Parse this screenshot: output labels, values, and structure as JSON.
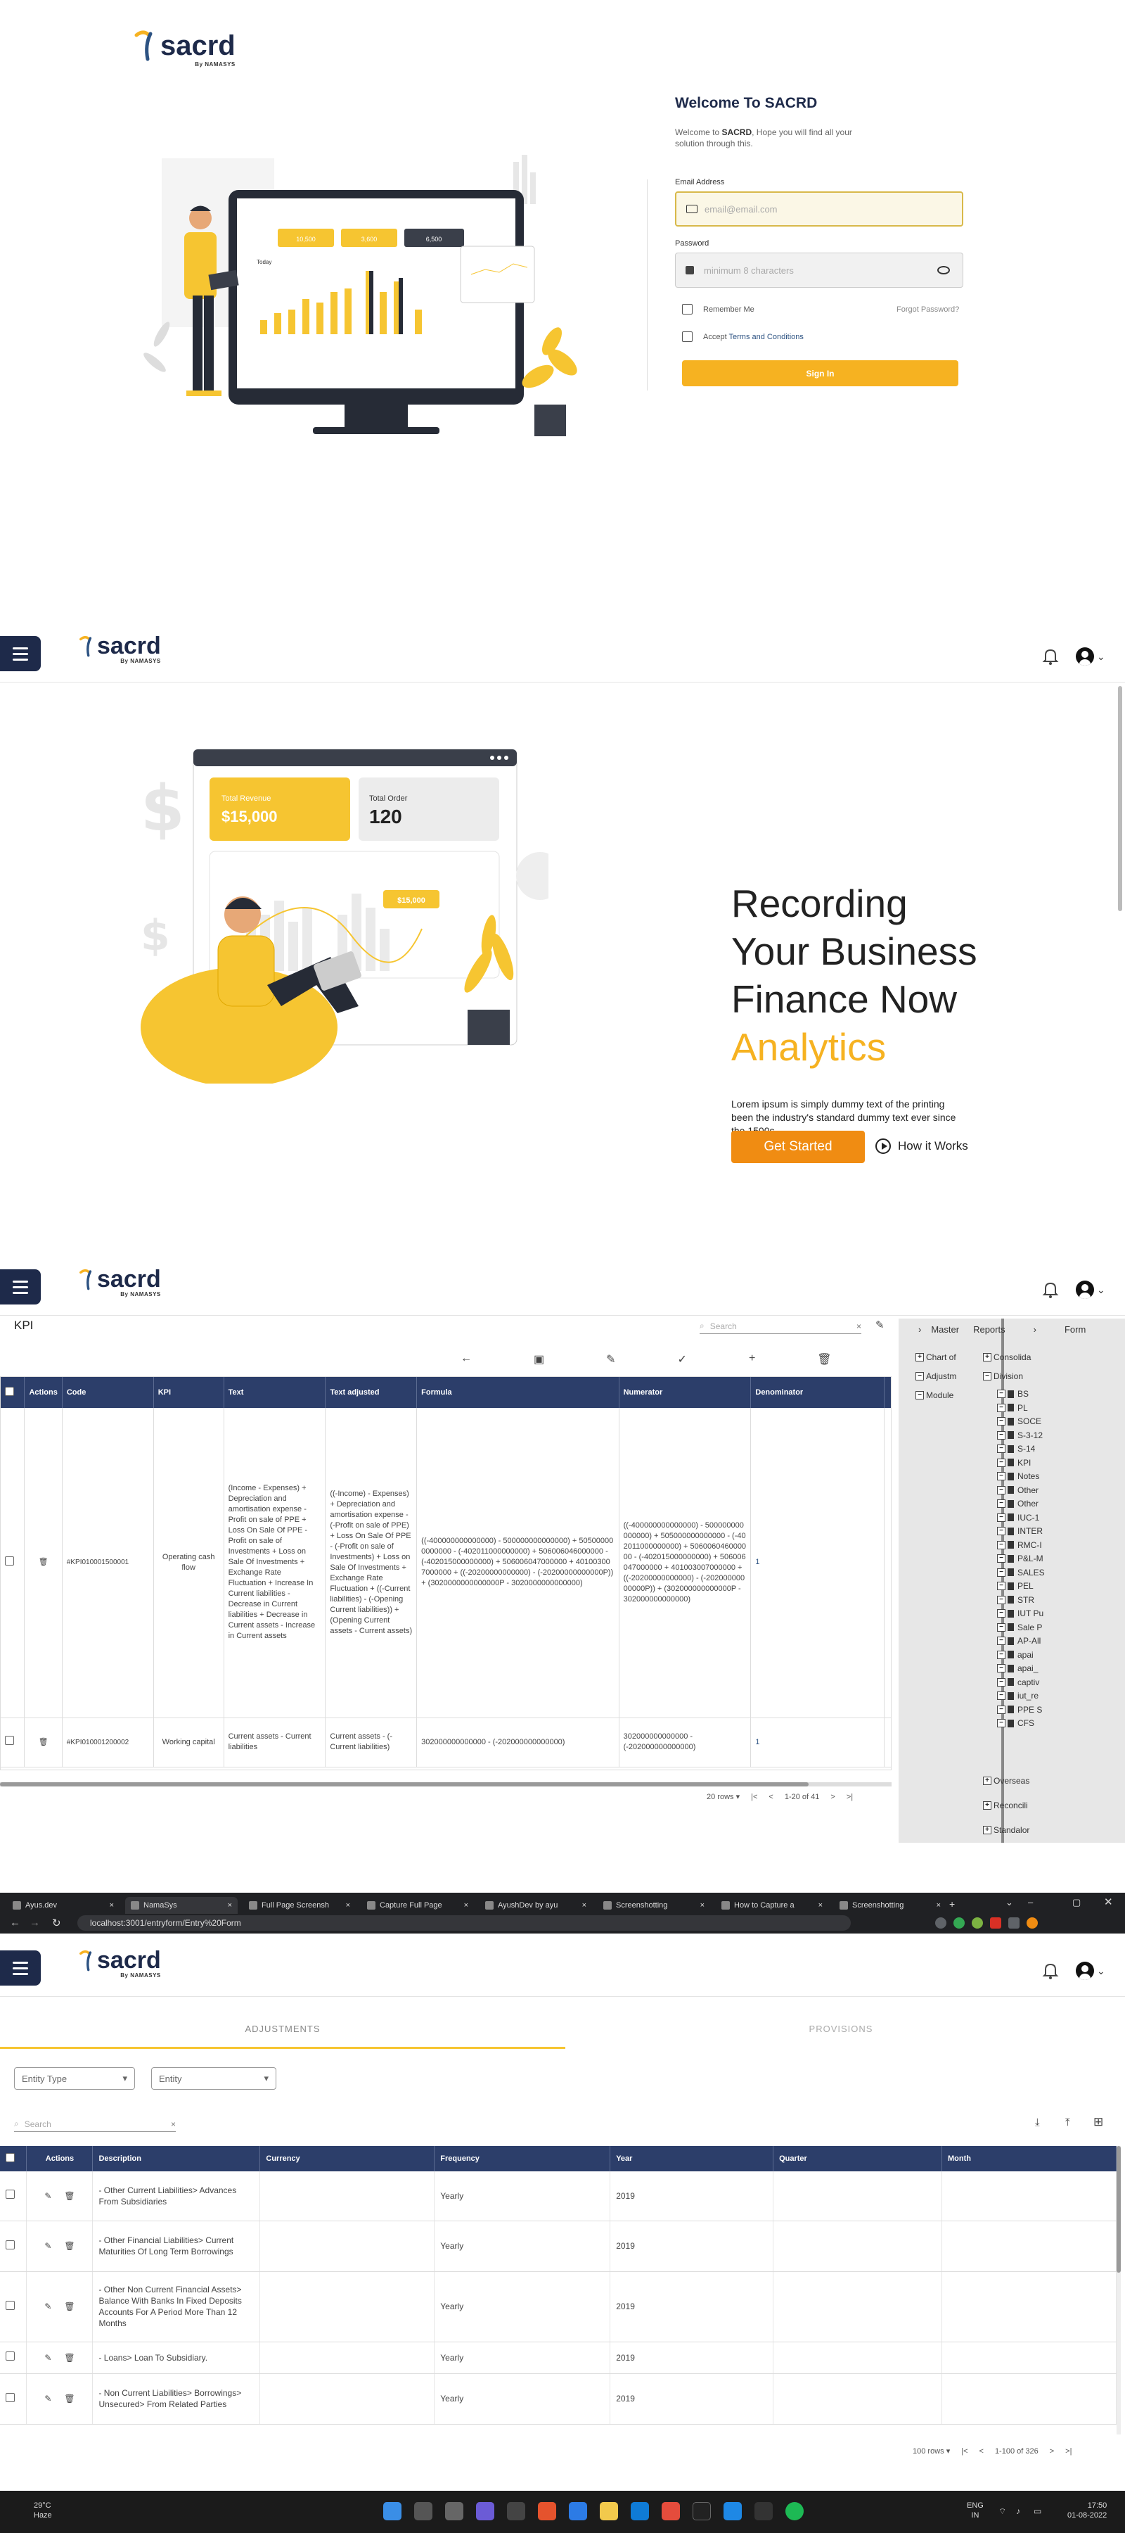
{
  "login": {
    "brand": "sacrd",
    "brand_sub": "By NAMASYS",
    "title": "Welcome To SACRD",
    "subtitle_prefix": "Welcome to ",
    "subtitle_brand": "SACRD",
    "subtitle_rest": ", Hope you will find all your solution through this.",
    "email_label": "Email Address",
    "email_placeholder": "email@email.com",
    "password_label": "Password",
    "password_placeholder": "minimum 8 characters",
    "remember_label": "Remember Me",
    "forgot_label": "Forgot Password?",
    "accept_prefix": "Accept ",
    "terms_label": "Terms and Conditions",
    "signin_label": "Sign In",
    "illus": {
      "stat1": "10,500",
      "stat2": "3,600",
      "stat3": "6,500",
      "today": "Today"
    },
    "accent": "#f6b221"
  },
  "landing": {
    "brand": "sacrd",
    "brand_sub": "By NAMASYS",
    "hero_line1": "Recording",
    "hero_line2": "Your Business",
    "hero_line3": "Finance Now",
    "hero_accent": "Analytics",
    "desc": "Lorem ipsum is simply dummy text of the printing been the industry's standard dummy text ever since the 1500s.",
    "cta_label": "Get Started",
    "how_label": "How it Works",
    "card1_label": "Total Revenue",
    "card1_value": "$15,000",
    "card2_label": "Total Order",
    "card2_value": "120",
    "chart_badge": "$15,000",
    "dollar_sign": "$"
  },
  "kpi": {
    "brand": "sacrd",
    "brand_sub": "By NAMASYS",
    "page_title": "KPI",
    "search_placeholder": "Search",
    "columns": [
      "Actions",
      "Code",
      "KPI",
      "Text",
      "Text adjusted",
      "Formula",
      "Numerator",
      "Denominator"
    ],
    "rows": [
      {
        "code": "#KPI010001500001",
        "kpi": "Operating cash flow",
        "text": "(Income - Expenses) + Depreciation and amortisation expense - Profit on sale of PPE + Loss On Sale Of PPE - Profit on sale of Investments + Loss on Sale Of Investments + Exchange Rate Fluctuation + Increase In Current liabilities - Decrease in Current liabilities + Decrease in Current assets - Increase in Current assets",
        "text_adj": "((-Income) - Expenses) + Depreciation and amortisation expense - (-Profit on sale of PPE) + Loss On Sale Of PPE - (-Profit on sale of Investments) + Loss on Sale Of Investments + Exchange Rate Fluctuation + ((-Current liabilities) - (-Opening Current liabilities)) + (Opening Current assets - Current assets)",
        "formula": "((-400000000000000) - 500000000000000) + 505000000000000 - (-402011000000000) + 506006046000000 - (-402015000000000) + 506006047000000 + 401003007000000 + ((-20200000000000) - (-20200000000000P)) + (3020000000000000P - 3020000000000000)",
        "numerator": "((-400000000000000) - 500000000000000) + 505000000000000 - (-402011000000000) + 506006046000000 - (-402015000000000) + 506006047000000 + 401003007000000 + ((-20200000000000) - (-20200000000000P)) + (302000000000000P - 302000000000000)",
        "denominator": "1"
      },
      {
        "code": "#KPI010001200002",
        "kpi": "Working capital",
        "text": "Current assets - Current liabilities",
        "text_adj": "Current assets - (-Current liabilities)",
        "formula": "302000000000000 - (-202000000000000)",
        "numerator": "302000000000000 - (-202000000000000)",
        "denominator": "1"
      }
    ],
    "pager_rows": "20 rows",
    "pager_range": "1-20 of 41",
    "side_tabs": [
      "Master",
      "Reports",
      "Form"
    ],
    "tree_top": [
      "Chart of",
      "Adjustm",
      "Module"
    ],
    "tree_consol": "Consolida",
    "tree_division": "Division",
    "tree_items": [
      "BS",
      "PL",
      "SOCE",
      "S-3-12",
      "S-14",
      "KPI",
      "Notes",
      "Other",
      "Other",
      "IUC-1",
      "INTER",
      "RMC-I",
      "P&L-M",
      "SALES",
      "PEL",
      "STR",
      "IUT Pu",
      "Sale P",
      "AP-All",
      "apai",
      "apai_",
      "captiv",
      "iut_re",
      "PPE S",
      "CFS"
    ],
    "tree_bottom": [
      "Overseas",
      "Reconcili",
      "Standalor"
    ]
  },
  "entry": {
    "brand": "sacrd",
    "brand_sub": "By NAMASYS",
    "tabs": [
      {
        "label": "Ayus.dev"
      },
      {
        "label": "NamaSys"
      },
      {
        "label": "Full Page Screensh"
      },
      {
        "label": "Capture Full Page"
      },
      {
        "label": "AyushDev by ayu"
      },
      {
        "label": "Screenshotting"
      },
      {
        "label": "How to Capture a"
      },
      {
        "label": "Screenshotting"
      }
    ],
    "url": "localhost:3001/entryform/Entry%20Form",
    "tab_adjust": "ADJUSTMENTS",
    "tab_prov": "PROVISIONS",
    "entity_type": "Entity Type",
    "entity": "Entity",
    "search_placeholder": "Search",
    "columns": [
      "Actions",
      "Description",
      "Currency",
      "Frequency",
      "Year",
      "Quarter",
      "Month"
    ],
    "rows": [
      {
        "desc": "- Other Current Liabilities> Advances From Subsidiaries",
        "freq": "Yearly",
        "year": "2019"
      },
      {
        "desc": "- Other Financial Liabilities> Current Maturities Of Long Term Borrowings",
        "freq": "Yearly",
        "year": "2019"
      },
      {
        "desc": "- Other Non Current Financial Assets> Balance With Banks In Fixed Deposits Accounts For A Period More Than 12 Months",
        "freq": "Yearly",
        "year": "2019"
      },
      {
        "desc": "- Loans> Loan To Subsidiary.",
        "freq": "Yearly",
        "year": "2019"
      },
      {
        "desc": "- Non Current Liabilities> Borrowings> Unsecured> From Related Parties",
        "freq": "Yearly",
        "year": "2019"
      }
    ],
    "pager_rows": "100 rows",
    "pager_range": "1-100 of 326",
    "weather_temp": "29°C",
    "weather_desc": "Haze",
    "lang": "ENG",
    "lang2": "IN",
    "clock_time": "17:50",
    "clock_date": "01-08-2022"
  }
}
